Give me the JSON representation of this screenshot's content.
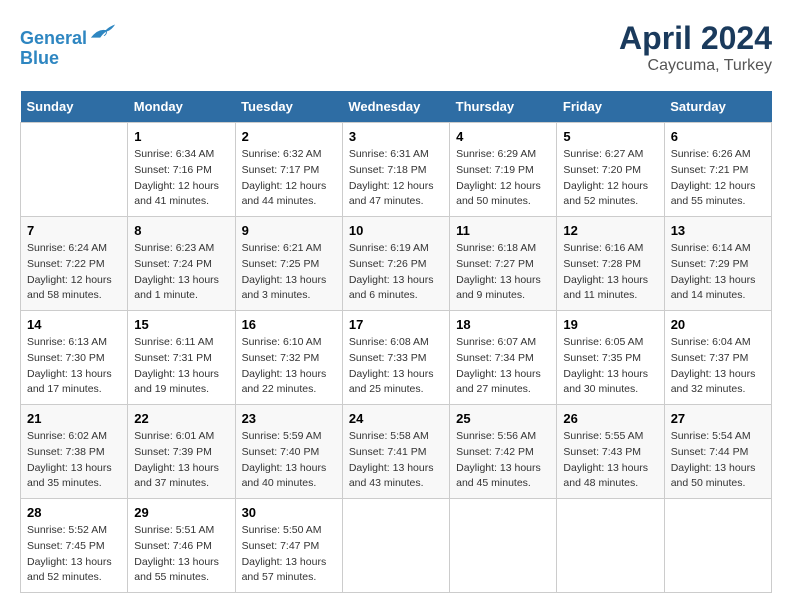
{
  "header": {
    "logo_line1": "General",
    "logo_line2": "Blue",
    "title": "April 2024",
    "subtitle": "Caycuma, Turkey"
  },
  "days_of_week": [
    "Sunday",
    "Monday",
    "Tuesday",
    "Wednesday",
    "Thursday",
    "Friday",
    "Saturday"
  ],
  "weeks": [
    [
      {
        "day": "",
        "info": ""
      },
      {
        "day": "1",
        "info": "Sunrise: 6:34 AM\nSunset: 7:16 PM\nDaylight: 12 hours\nand 41 minutes."
      },
      {
        "day": "2",
        "info": "Sunrise: 6:32 AM\nSunset: 7:17 PM\nDaylight: 12 hours\nand 44 minutes."
      },
      {
        "day": "3",
        "info": "Sunrise: 6:31 AM\nSunset: 7:18 PM\nDaylight: 12 hours\nand 47 minutes."
      },
      {
        "day": "4",
        "info": "Sunrise: 6:29 AM\nSunset: 7:19 PM\nDaylight: 12 hours\nand 50 minutes."
      },
      {
        "day": "5",
        "info": "Sunrise: 6:27 AM\nSunset: 7:20 PM\nDaylight: 12 hours\nand 52 minutes."
      },
      {
        "day": "6",
        "info": "Sunrise: 6:26 AM\nSunset: 7:21 PM\nDaylight: 12 hours\nand 55 minutes."
      }
    ],
    [
      {
        "day": "7",
        "info": "Sunrise: 6:24 AM\nSunset: 7:22 PM\nDaylight: 12 hours\nand 58 minutes."
      },
      {
        "day": "8",
        "info": "Sunrise: 6:23 AM\nSunset: 7:24 PM\nDaylight: 13 hours\nand 1 minute."
      },
      {
        "day": "9",
        "info": "Sunrise: 6:21 AM\nSunset: 7:25 PM\nDaylight: 13 hours\nand 3 minutes."
      },
      {
        "day": "10",
        "info": "Sunrise: 6:19 AM\nSunset: 7:26 PM\nDaylight: 13 hours\nand 6 minutes."
      },
      {
        "day": "11",
        "info": "Sunrise: 6:18 AM\nSunset: 7:27 PM\nDaylight: 13 hours\nand 9 minutes."
      },
      {
        "day": "12",
        "info": "Sunrise: 6:16 AM\nSunset: 7:28 PM\nDaylight: 13 hours\nand 11 minutes."
      },
      {
        "day": "13",
        "info": "Sunrise: 6:14 AM\nSunset: 7:29 PM\nDaylight: 13 hours\nand 14 minutes."
      }
    ],
    [
      {
        "day": "14",
        "info": "Sunrise: 6:13 AM\nSunset: 7:30 PM\nDaylight: 13 hours\nand 17 minutes."
      },
      {
        "day": "15",
        "info": "Sunrise: 6:11 AM\nSunset: 7:31 PM\nDaylight: 13 hours\nand 19 minutes."
      },
      {
        "day": "16",
        "info": "Sunrise: 6:10 AM\nSunset: 7:32 PM\nDaylight: 13 hours\nand 22 minutes."
      },
      {
        "day": "17",
        "info": "Sunrise: 6:08 AM\nSunset: 7:33 PM\nDaylight: 13 hours\nand 25 minutes."
      },
      {
        "day": "18",
        "info": "Sunrise: 6:07 AM\nSunset: 7:34 PM\nDaylight: 13 hours\nand 27 minutes."
      },
      {
        "day": "19",
        "info": "Sunrise: 6:05 AM\nSunset: 7:35 PM\nDaylight: 13 hours\nand 30 minutes."
      },
      {
        "day": "20",
        "info": "Sunrise: 6:04 AM\nSunset: 7:37 PM\nDaylight: 13 hours\nand 32 minutes."
      }
    ],
    [
      {
        "day": "21",
        "info": "Sunrise: 6:02 AM\nSunset: 7:38 PM\nDaylight: 13 hours\nand 35 minutes."
      },
      {
        "day": "22",
        "info": "Sunrise: 6:01 AM\nSunset: 7:39 PM\nDaylight: 13 hours\nand 37 minutes."
      },
      {
        "day": "23",
        "info": "Sunrise: 5:59 AM\nSunset: 7:40 PM\nDaylight: 13 hours\nand 40 minutes."
      },
      {
        "day": "24",
        "info": "Sunrise: 5:58 AM\nSunset: 7:41 PM\nDaylight: 13 hours\nand 43 minutes."
      },
      {
        "day": "25",
        "info": "Sunrise: 5:56 AM\nSunset: 7:42 PM\nDaylight: 13 hours\nand 45 minutes."
      },
      {
        "day": "26",
        "info": "Sunrise: 5:55 AM\nSunset: 7:43 PM\nDaylight: 13 hours\nand 48 minutes."
      },
      {
        "day": "27",
        "info": "Sunrise: 5:54 AM\nSunset: 7:44 PM\nDaylight: 13 hours\nand 50 minutes."
      }
    ],
    [
      {
        "day": "28",
        "info": "Sunrise: 5:52 AM\nSunset: 7:45 PM\nDaylight: 13 hours\nand 52 minutes."
      },
      {
        "day": "29",
        "info": "Sunrise: 5:51 AM\nSunset: 7:46 PM\nDaylight: 13 hours\nand 55 minutes."
      },
      {
        "day": "30",
        "info": "Sunrise: 5:50 AM\nSunset: 7:47 PM\nDaylight: 13 hours\nand 57 minutes."
      },
      {
        "day": "",
        "info": ""
      },
      {
        "day": "",
        "info": ""
      },
      {
        "day": "",
        "info": ""
      },
      {
        "day": "",
        "info": ""
      }
    ]
  ]
}
